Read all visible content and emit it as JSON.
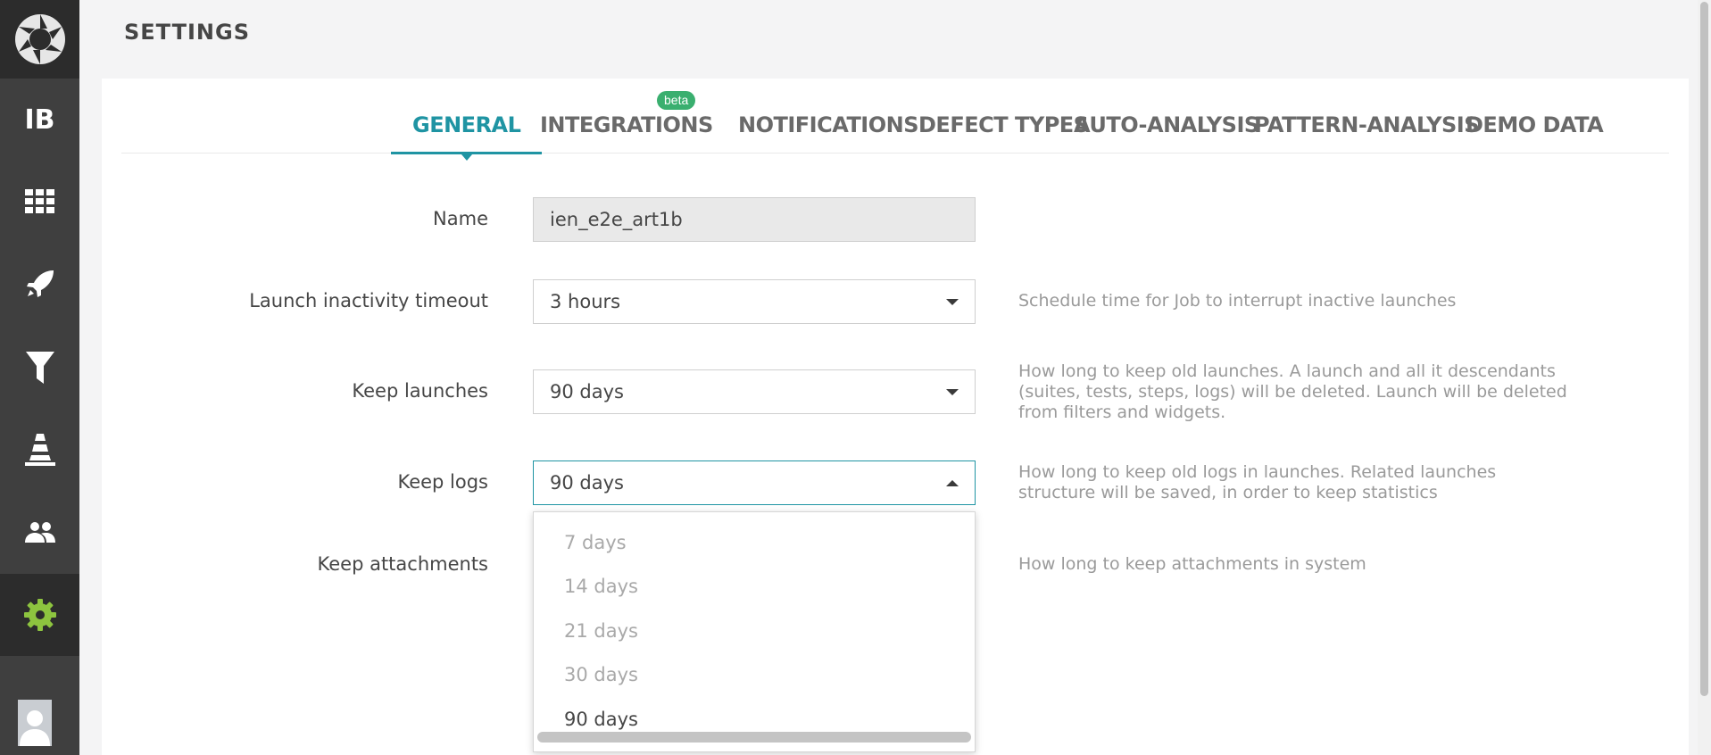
{
  "sidebar": {
    "project_initials": "IB",
    "items": [
      {
        "name": "dashboard-icon"
      },
      {
        "name": "launches-icon"
      },
      {
        "name": "filters-icon"
      },
      {
        "name": "debug-icon"
      },
      {
        "name": "members-icon"
      },
      {
        "name": "settings-icon"
      }
    ],
    "active_color": "#8dc43f"
  },
  "header": {
    "title": "SETTINGS"
  },
  "tabs": [
    {
      "label": "GENERAL",
      "active": true
    },
    {
      "label": "INTEGRATIONS",
      "badge": "beta"
    },
    {
      "label": "NOTIFICATIONS"
    },
    {
      "label": "DEFECT TYPES"
    },
    {
      "label": "AUTO-ANALYSIS"
    },
    {
      "label": "PATTERN-ANALYSIS"
    },
    {
      "label": "DEMO DATA"
    }
  ],
  "form": {
    "name": {
      "label": "Name",
      "value": "ien_e2e_art1b"
    },
    "launch_timeout": {
      "label": "Launch inactivity timeout",
      "value": "3 hours",
      "hint": "Schedule time for Job to interrupt inactive launches"
    },
    "keep_launches": {
      "label": "Keep launches",
      "value": "90 days",
      "hint": "How long to keep old launches. A launch and all it descendants (suites, tests, steps, logs) will be deleted. Launch will be deleted from filters and widgets."
    },
    "keep_logs": {
      "label": "Keep logs",
      "value": "90 days",
      "hint": "How long to keep old logs in launches. Related launches structure will be saved, in order to keep statistics"
    },
    "keep_attachments": {
      "label": "Keep attachments",
      "hint": "How long to keep attachments in system"
    }
  },
  "dropdown": {
    "options": [
      "7 days",
      "14 days",
      "21 days",
      "30 days",
      "90 days"
    ],
    "selected": "90 days"
  },
  "colors": {
    "accent": "#1f94a3",
    "beta_badge": "#3aaf6f"
  }
}
